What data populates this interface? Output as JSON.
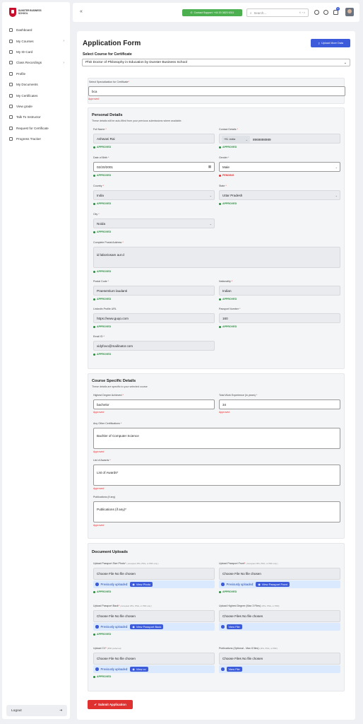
{
  "sidebar": {
    "logo_text": "DUNSTER BUSINESS SCHOOL",
    "items": [
      {
        "label": "Dashboard",
        "icon": "dashboard-icon",
        "chevron": false
      },
      {
        "label": "My Courses",
        "icon": "book-icon",
        "chevron": true
      },
      {
        "label": "My ID Card",
        "icon": "id-card-icon",
        "chevron": false
      },
      {
        "label": "Class Recordings",
        "icon": "video-icon",
        "chevron": true
      },
      {
        "label": "Profile",
        "icon": "user-icon",
        "chevron": false
      },
      {
        "label": "My Documents",
        "icon": "document-icon",
        "chevron": false
      },
      {
        "label": "My Certificates",
        "icon": "certificate-icon",
        "chevron": false
      },
      {
        "label": "View grade",
        "icon": "grade-icon",
        "chevron": false
      },
      {
        "label": "Talk To Instructor",
        "icon": "chat-icon",
        "chevron": false
      },
      {
        "label": "Request for Certificate",
        "icon": "request-icon",
        "chevron": false
      },
      {
        "label": "Progress Tracker",
        "icon": "progress-icon",
        "chevron": false
      }
    ],
    "logout": "Logout"
  },
  "topbar": {
    "support": "Contact Support: +44 20 3823 6311",
    "search_placeholder": "Search...",
    "search_kbd": "K + k",
    "notification_count": "3"
  },
  "page": {
    "title": "Application Form",
    "upload_more": "Upload More Data",
    "course_label": "Select Course for Certificate",
    "course_value": "PhD Doctor of Philosophy in Education by Dunster Business School"
  },
  "specialization": {
    "label": "Select Specialization for Certificate",
    "value": "bca",
    "status": "Approved"
  },
  "personal": {
    "title": "Personal Details",
    "subtitle": "These details will be auto-filled from your previous submissions where available.",
    "full_name": {
      "label": "Full Name",
      "value": "Ashwani Rai",
      "status": "APPROVED"
    },
    "contact": {
      "label": "Contact Details",
      "code": "+91 -India",
      "value": "8969898989",
      "status": "APPROVED"
    },
    "dob": {
      "label": "Date of Birth",
      "value": "02/20/2001",
      "status": "APPROVED"
    },
    "gender": {
      "label": "Gender",
      "value": "Male",
      "status": "PENDING"
    },
    "country": {
      "label": "Country",
      "value": "India",
      "status": "APPROVED"
    },
    "state": {
      "label": "State",
      "value": "Uttar Pradesh",
      "status": "APPROVED"
    },
    "city": {
      "label": "City",
      "value": "Noida",
      "status": "APPROVED"
    },
    "address": {
      "label": "Complete Postal Address",
      "value": "id laboriosam aut d",
      "status": "APPROVED"
    },
    "postal": {
      "label": "Postal Code",
      "value": "Praesentium laudanti",
      "status": "APPROVED"
    },
    "nationality": {
      "label": "Nationality",
      "value": "Indian",
      "status": "APPROVED"
    },
    "linkedin": {
      "label": "LinkedIn Profile URL",
      "value": "https://www.guqo.com",
      "status": "APPROVED"
    },
    "passport": {
      "label": "Passport Number",
      "value": "160",
      "status": "APPROVED"
    },
    "email": {
      "label": "Email ID",
      "value": "xidyfovo@mailinator.com",
      "status": "APPROVED"
    }
  },
  "course_details": {
    "title": "Course Specific Details",
    "subtitle": "These details are specific to your selected course",
    "degree": {
      "label": "Highest Degree Achieved",
      "value": "bachelor",
      "status": "Approved"
    },
    "experience": {
      "label": "Total Work Experience (in years)",
      "value": "34",
      "status": "Approved"
    },
    "certs": {
      "label": "Any Other Certifications",
      "value": "Bachler of Computer Science",
      "status": "Approved"
    },
    "awards": {
      "label": "List of Awards",
      "value": "List of Awards*",
      "status": "Approved"
    },
    "pubs": {
      "label": "Publications (if any)",
      "value": "Publications (if any)*",
      "status": "Approved"
    }
  },
  "documents": {
    "title": "Document Uploads",
    "passport_photo": {
      "label": "Upload Passport Size Photo",
      "hint": "( Accepted JPG, PNG, or PDF only )",
      "file": "Choose File No file chosen",
      "prev": "Previously uploaded:",
      "view": "View Photo",
      "status": "APPROVED"
    },
    "passport_front": {
      "label": "Upload Passport Front",
      "hint": "( Accepted JPG, PNG, or PDF only )",
      "file": "Choose File No file chosen",
      "prev": "Previously uploaded:",
      "view": "View Passport Front",
      "status": "APPROVED"
    },
    "passport_back": {
      "label": "Upload Passport Back",
      "hint": "( Accepted JPG, PNG, or PDF only )",
      "file": "Choose File No file chosen",
      "prev": "Previously uploaded:",
      "view": "View Passport Back",
      "status": "APPROVED"
    },
    "degree": {
      "label": "Upload Highest Degree (Max 3 Files)",
      "hint": "(JPG, PNG, or PDF)",
      "file": "Choose Files No file chosen",
      "view": "View File"
    },
    "cv": {
      "label": "Upload CV",
      "hint": "(PDF preferred)",
      "file": "Choose File No file chosen",
      "prev": "Previously uploaded:",
      "view": "View cv",
      "status": "APPROVED"
    },
    "publications": {
      "label": "Publications (Optional - Max 8 files)",
      "hint": "(JPG, PNG, or PDF)",
      "file": "Choose Files No file chosen",
      "view": "View File"
    }
  },
  "submit": "Submit Application"
}
